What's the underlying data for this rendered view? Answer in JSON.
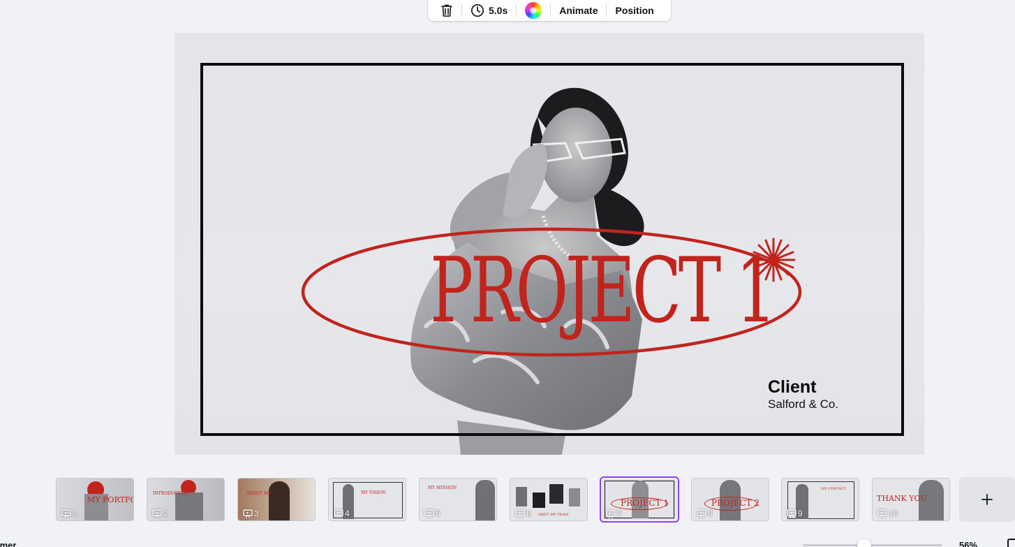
{
  "toolbar": {
    "duration": "5.0s",
    "animate_label": "Animate",
    "position_label": "Position",
    "icons": [
      "trash-icon",
      "clock-icon",
      "color-wheel-icon"
    ]
  },
  "slide": {
    "title": "PROJECT 1",
    "client_label": "Client",
    "client_name": "Salford & Co.",
    "accent_color": "#c0241c",
    "border_color": "#0b0b0b"
  },
  "filmstrip": {
    "selected_page": "7",
    "pages": [
      {
        "number": "1",
        "caption": "MY PORTFOLIO"
      },
      {
        "number": "2",
        "caption": "INTRODUCTION"
      },
      {
        "number": "3",
        "caption": "ABOUT ME"
      },
      {
        "number": "4",
        "caption": "MY VISION"
      },
      {
        "number": "5",
        "caption": "MY MISSION"
      },
      {
        "number": "6",
        "caption": "MEET MY TEAM"
      },
      {
        "number": "7",
        "caption": "PROJECT 1"
      },
      {
        "number": "8",
        "caption": "PROJECT 2"
      },
      {
        "number": "9",
        "caption": "MY CONTACT"
      },
      {
        "number": "10",
        "caption": "THANK YOU"
      }
    ],
    "add_icon": "plus-icon",
    "selection_color": "#8b3dff"
  },
  "bottom_bar": {
    "timer_label": "imer",
    "zoom_value": "56%",
    "zoom_level": 0.45
  }
}
